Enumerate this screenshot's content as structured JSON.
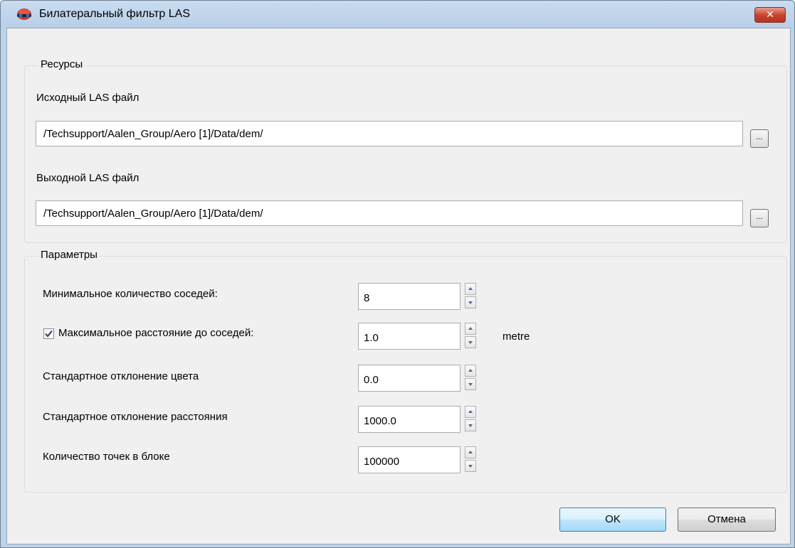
{
  "window": {
    "title": "Билатеральный фильтр LAS",
    "app_icon": "stereo-glasses-icon",
    "close_label": "✕"
  },
  "resources": {
    "title": "Ресурсы",
    "input_label": "Исходный LAS файл",
    "input_value": "/Techsupport/Aalen_Group/Aero [1]/Data/dem/",
    "output_label": "Выходной LAS файл",
    "output_value": "/Techsupport/Aalen_Group/Aero [1]/Data/dem/",
    "browse_label": "..."
  },
  "params": {
    "title": "Параметры",
    "min_neighbors_label": "Минимальное количество соседей:",
    "min_neighbors_value": "8",
    "max_distance_label": "Максимальное расстояние до соседей:",
    "max_distance_checked": true,
    "max_distance_value": "1.0",
    "max_distance_unit": "metre",
    "color_std_label": "Стандартное отклонение цвета",
    "color_std_value": "0.0",
    "dist_std_label": "Стандартное отклонение расстояния",
    "dist_std_value": "1000.0",
    "points_per_block_label": "Количество точек в блоке",
    "points_per_block_value": "100000"
  },
  "buttons": {
    "ok": "OK",
    "cancel": "Отмена"
  },
  "colors": {
    "title_bar": "#bcd3ea",
    "close_button": "#c9452f",
    "default_button_border": "#3c7fb1"
  }
}
